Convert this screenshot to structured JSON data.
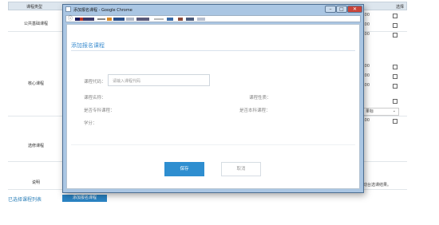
{
  "background": {
    "header": {
      "type_label": "课程类型",
      "select_label": "选择"
    },
    "categories": [
      "公共基础课程",
      "核心课程",
      "选修课程",
      "说明"
    ],
    "right_times": [
      ":00",
      ":00",
      ":00",
      ":00",
      ":00",
      ":00",
      ":00"
    ],
    "select_value": "果标",
    "note_text": "动台选课结果。",
    "selected_list_label": "已选择课程列表",
    "add_button_label": "添加报名课程"
  },
  "window": {
    "title": "添加报名课程 - Google Chrome",
    "controls": {
      "minimize": "–",
      "maximize": "□",
      "close": "✕"
    },
    "url_info_icon": "ⓘ"
  },
  "dialog": {
    "title": "添加报名课程",
    "course_code_label": "课程代码：",
    "course_code_placeholder": "请输入课程代码",
    "course_name_label": "课程名称：",
    "course_nature_label": "课程性质：",
    "vocational_label": "是否专科课程：",
    "undergrad_label": "是否本科课程：",
    "credits_label": "学分：",
    "save_label": "保存",
    "cancel_label": "取消"
  },
  "colors": {
    "accent": "#2e8ed0",
    "titlebar": "#aac6e3",
    "close": "#c9453a"
  }
}
